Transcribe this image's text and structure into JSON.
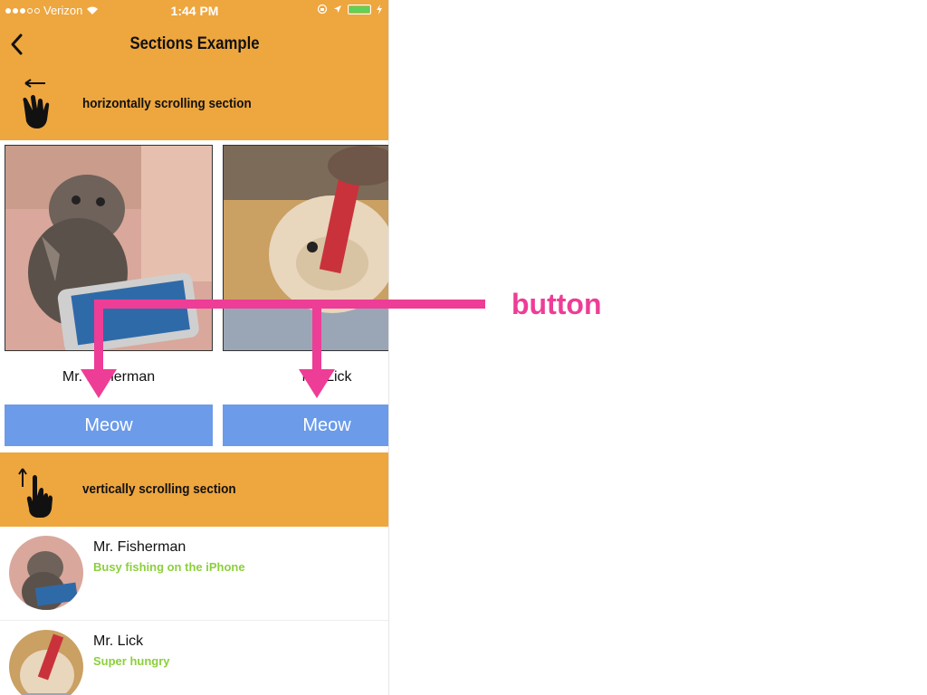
{
  "status": {
    "carrier": "Verizon",
    "time": "1:44 PM"
  },
  "nav": {
    "title": "Sections Example"
  },
  "sections": {
    "horizontal": {
      "label": "horizontally scrolling section"
    },
    "vertical": {
      "label": "vertically scrolling section"
    }
  },
  "cards": [
    {
      "name": "Mr. Fisherman",
      "button": "Meow"
    },
    {
      "name": "Mr. Lick",
      "button": "Meow"
    }
  ],
  "list": [
    {
      "name": "Mr. Fisherman",
      "subtitle": "Busy fishing on the iPhone"
    },
    {
      "name": "Mr. Lick",
      "subtitle": "Super hungry"
    }
  ],
  "annotation": {
    "label": "button"
  },
  "colors": {
    "bar": "#eea63e",
    "button": "#6b9be9",
    "subtitle": "#8ccf3c",
    "annotation": "#ee3d96"
  },
  "icons": {
    "back": "chevron-left-icon",
    "swipe": "hand-swipe-left-icon",
    "scroll": "hand-scroll-up-icon"
  },
  "status_icons": {
    "battery_level": 1.0
  }
}
